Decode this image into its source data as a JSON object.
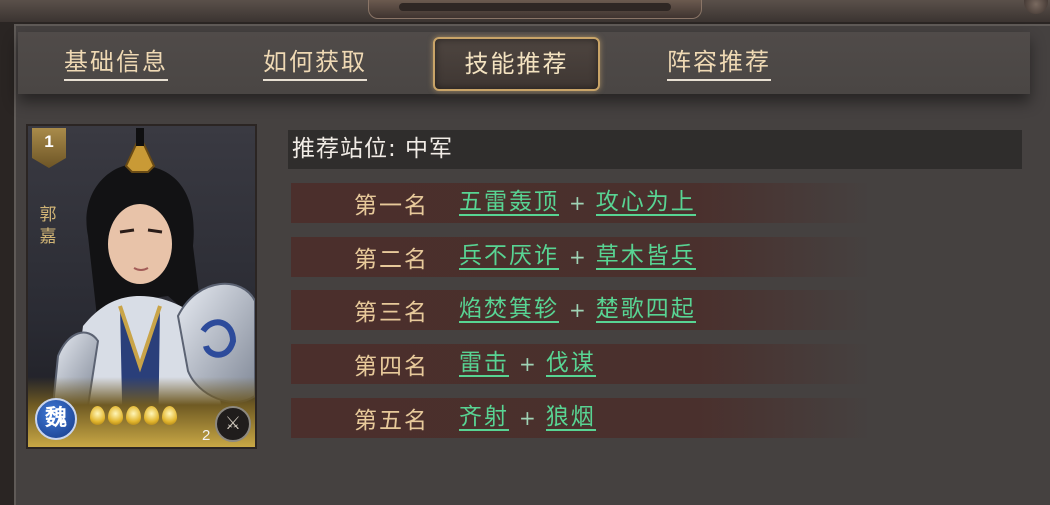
{
  "tabs": [
    {
      "label": "基础信息",
      "active": false
    },
    {
      "label": "如何获取",
      "active": false
    },
    {
      "label": "技能推荐",
      "active": true
    },
    {
      "label": "阵容推荐",
      "active": false
    }
  ],
  "hero": {
    "level": "1",
    "name": "郭嘉",
    "faction": "魏",
    "stars": 5,
    "cost": "2",
    "type_icon": "archer-shield-icon"
  },
  "recommendation": {
    "position_text": "推荐站位: 中军",
    "ranks": [
      {
        "label": "第一名",
        "skill1": "五雷轰顶",
        "skill2": "攻心为上"
      },
      {
        "label": "第二名",
        "skill1": "兵不厌诈",
        "skill2": "草木皆兵"
      },
      {
        "label": "第三名",
        "skill1": "焰焚箕轸",
        "skill2": "楚歌四起"
      },
      {
        "label": "第四名",
        "skill1": "雷击",
        "skill2": "伐谋"
      },
      {
        "label": "第五名",
        "skill1": "齐射",
        "skill2": "狼烟"
      }
    ],
    "plus": "+"
  },
  "colors": {
    "accent_gold": "#c9a468",
    "skill_green": "#58d493",
    "rank_text": "#e7c99a"
  }
}
